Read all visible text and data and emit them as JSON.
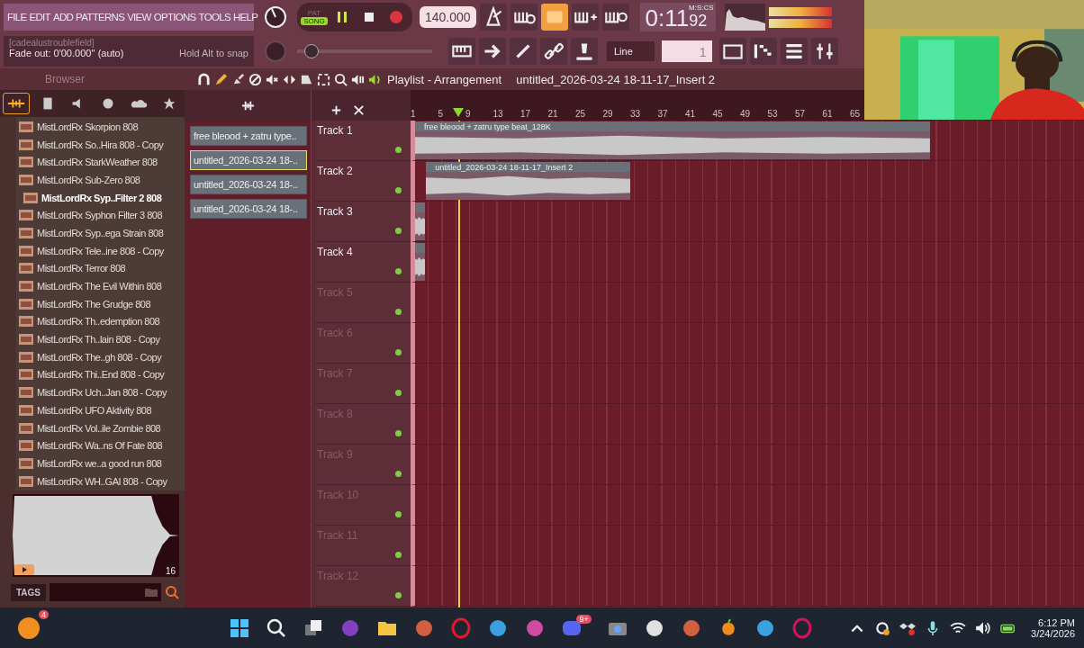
{
  "menu": [
    "FILE",
    "EDIT",
    "ADD",
    "PATTERNS",
    "VIEW",
    "OPTIONS",
    "TOOLS",
    "HELP"
  ],
  "hint": {
    "title": "[cadealustroublefield]",
    "text": "Fade out:  0'00.000'' (auto)",
    "snap": "Hold Alt to snap"
  },
  "transport": {
    "modes": [
      {
        "label": "PAT",
        "selected": false
      },
      {
        "label": "SONG",
        "selected": true
      }
    ],
    "tempo": "140.000",
    "time": "0:11",
    "time_cs": "92",
    "time_unit": "M:S:CS"
  },
  "toolbar": {
    "snap": "Line",
    "pattern": "1",
    "master": {
      "level": 0.06
    }
  },
  "browser": {
    "title": "Browser",
    "items": [
      {
        "name": "MistLordRx Skorpion 808",
        "selected": false
      },
      {
        "name": "MistLordRx So..Hira 808 - Copy",
        "selected": false
      },
      {
        "name": "MistLordRx StarkWeather 808",
        "selected": false
      },
      {
        "name": "MistLordRx Sub-Zero 808",
        "selected": false
      },
      {
        "name": "MistLordRx Syp..Filter 2 808",
        "selected": true
      },
      {
        "name": "MistLordRx Syphon Filter 3 808",
        "selected": false
      },
      {
        "name": "MistLordRx Syp..ega Strain 808",
        "selected": false
      },
      {
        "name": "MistLordRx Tele..ine 808 - Copy",
        "selected": false
      },
      {
        "name": "MistLordRx Terror 808",
        "selected": false
      },
      {
        "name": "MistLordRx The Evil Within 808",
        "selected": false
      },
      {
        "name": "MistLordRx The Grudge 808",
        "selected": false
      },
      {
        "name": "MistLordRx Th..edemption 808",
        "selected": false
      },
      {
        "name": "MistLordRx Th..lain 808 - Copy",
        "selected": false
      },
      {
        "name": "MistLordRx The..gh 808 - Copy",
        "selected": false
      },
      {
        "name": "MistLordRx Thi..End 808 - Copy",
        "selected": false
      },
      {
        "name": "MistLordRx Uch..Jan 808 - Copy",
        "selected": false
      },
      {
        "name": "MistLordRx UFO Aktivity 808",
        "selected": false
      },
      {
        "name": "MistLordRx Vol..ile Zombie 808",
        "selected": false
      },
      {
        "name": "MistLordRx Wa..ns Of Fate 808",
        "selected": false
      },
      {
        "name": "MistLordRx we..a good run 808",
        "selected": false
      },
      {
        "name": "MistLordRx WH..GAI 808 - Copy",
        "selected": false
      }
    ],
    "preview_count": "16",
    "tags_label": "TAGS"
  },
  "picker": [
    {
      "name": "free bleood + zatru type..",
      "selected": false
    },
    {
      "name": "untitled_2026-03-24 18-..",
      "selected": true
    },
    {
      "name": "untitled_2026-03-24 18-..",
      "selected": false
    },
    {
      "name": "untitled_2026-03-24 18-..",
      "selected": false
    }
  ],
  "playlist": {
    "title": "Playlist - Arrangement",
    "path": "untitled_2026-03-24 18-11-17_Insert 2",
    "ruler": [
      "1",
      "5",
      "9",
      "13",
      "17",
      "21",
      "25",
      "29",
      "33",
      "37",
      "41",
      "45",
      "49",
      "53",
      "57",
      "61",
      "65"
    ],
    "tracks": [
      {
        "name": "Track 1",
        "clip": {
          "kind": "audio",
          "name": "free bleood + zatru type beat_128K"
        }
      },
      {
        "name": "Track 2",
        "clip": {
          "kind": "audio",
          "name": "untitled_2026-03-24 18-11-17_Insert 2"
        }
      },
      {
        "name": "Track 3",
        "clip": {
          "kind": "audio"
        }
      },
      {
        "name": "Track 4",
        "clip": {
          "kind": "audio"
        }
      },
      {
        "name": "Track 5"
      },
      {
        "name": "Track 6"
      },
      {
        "name": "Track 7"
      },
      {
        "name": "Track 8"
      },
      {
        "name": "Track 9"
      },
      {
        "name": "Track 10"
      },
      {
        "name": "Track 11"
      },
      {
        "name": "Track 12"
      }
    ]
  },
  "taskbar": {
    "badges": [
      "4",
      "9+"
    ],
    "time": "6:12 PM",
    "date": "3/24/2026"
  }
}
